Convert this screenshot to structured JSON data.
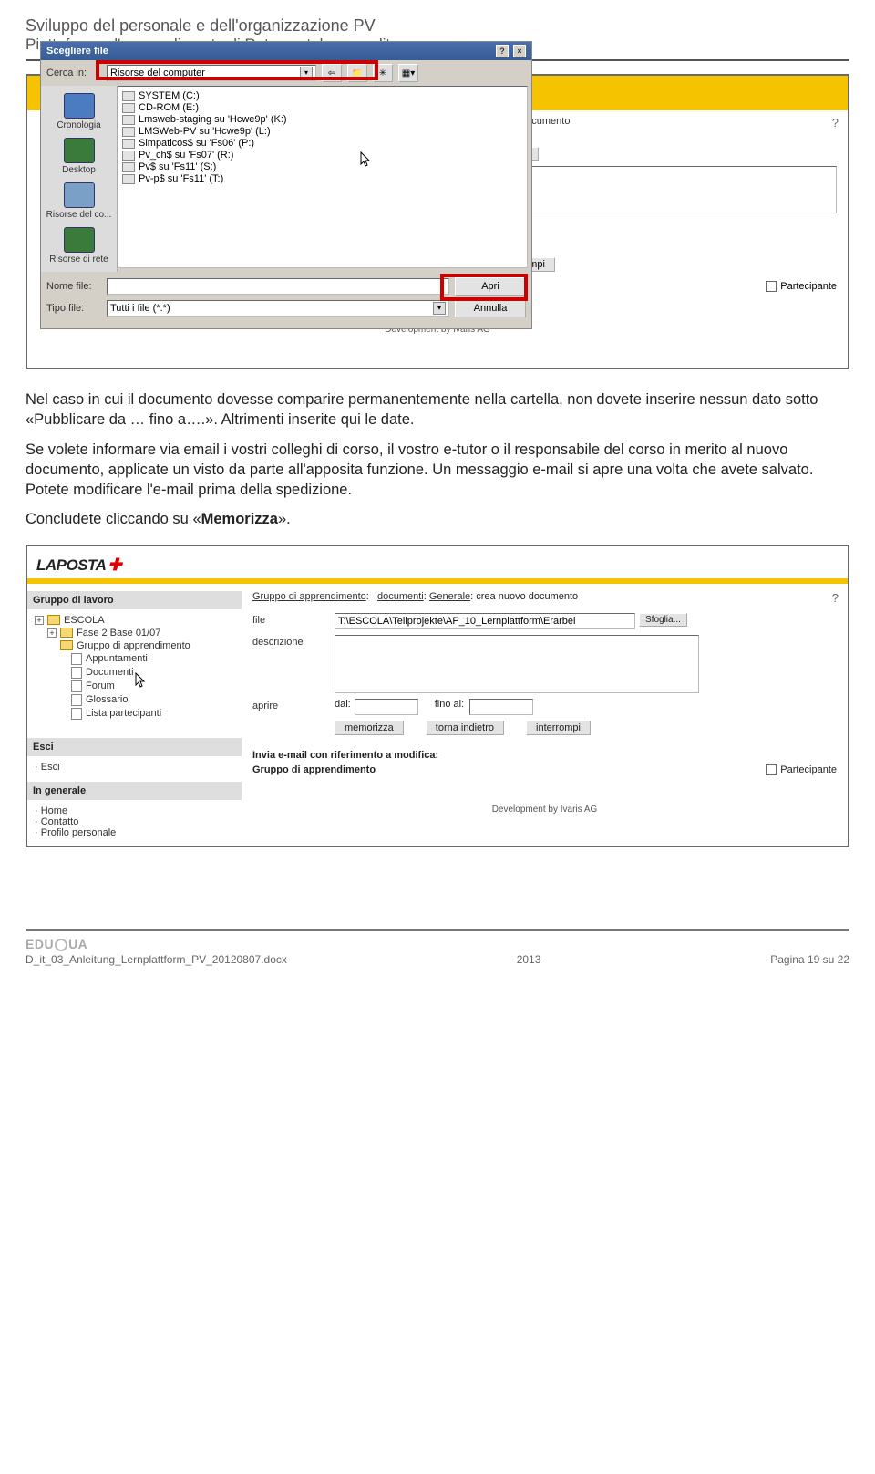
{
  "header": {
    "line1": "Sviluppo del personale e dell'organizzazione PV",
    "line2": "Piattaforma d'apprendimento di Rete postale e vendita"
  },
  "filepicker": {
    "title": "Scegliere file",
    "search_in_label": "Cerca in:",
    "search_in_value": "Risorse del computer",
    "drives": [
      "SYSTEM (C:)",
      "CD-ROM (E:)",
      "Lmsweb-staging su 'Hcwe9p' (K:)",
      "LMSWeb-PV su 'Hcwe9p' (L:)",
      "Simpaticos$ su 'Fs06' (P:)",
      "Pv_ch$ su 'Fs07' (R:)",
      "Pv$ su 'Fs11' (S:)",
      "Pv-p$ su 'Fs11' (T:)"
    ],
    "places": [
      "Cronologia",
      "Desktop",
      "Risorse del co...",
      "Risorse di rete"
    ],
    "file_label": "Nome file:",
    "type_label": "Tipo file:",
    "type_value": "Tutti i file (*.*)",
    "open_btn": "Apri",
    "cancel_btn": "Annulla"
  },
  "under": {
    "crumb_tail": "nuovo documento",
    "browse_btn": "Sfoglia...",
    "interrupt_btn": "interrompi",
    "participant_lbl": "Partecipante",
    "profile_link": "Profilo personale",
    "devline": "Development by Ivaris AG"
  },
  "copy": {
    "p1": "Nel caso in cui il documento dovesse comparire permanentemente nella cartella, non dovete inserire nessun dato sotto «Pubblicare da … fino a….». Altrimenti inserite qui le date.",
    "p2": "Se volete informare via email i vostri colleghi di corso, il vostro e-tutor o il responsabile del corso in merito al nuovo documento, applicate un visto da parte all'apposita funzione. Un messaggio e-mail si apre una volta che avete salvato. Potete modificare l'e-mail prima della spedizione.",
    "p3_pre": "Concludete cliccando su «",
    "p3_bold": "Memorizza",
    "p3_post": "»."
  },
  "shot2": {
    "logo_text": "LAPOSTA",
    "sections": {
      "group": "Gruppo di lavoro",
      "exit": "Esci",
      "general": "In generale"
    },
    "tree": {
      "root": "ESCOLA",
      "phase": "Fase 2 Base 01/07",
      "ga": "Gruppo di apprendimento",
      "items": [
        "Appuntamenti",
        "Documenti",
        "Forum",
        "Glossario",
        "Lista partecipanti"
      ]
    },
    "exit_link": "Esci",
    "general_links": [
      "Home",
      "Contatto",
      "Profilo personale"
    ],
    "breadcrumb": {
      "a": "Gruppo di apprendimento",
      "b": "documenti",
      "c": "Generale",
      "tail": "crea nuovo documento"
    },
    "form": {
      "file_lbl": "file",
      "file_val": "T:\\ESCOLA\\Teilprojekte\\AP_10_Lernplattform\\Erarbei",
      "browse": "Sfoglia...",
      "desc_lbl": "descrizione",
      "open_lbl": "aprire",
      "from_lbl": "dal:",
      "to_lbl": "fino al:",
      "save": "memorizza",
      "back": "torna indietro",
      "interrupt": "interrompi"
    },
    "sub": {
      "title": "Invia e-mail con riferimento a modifica:",
      "row_l": "Gruppo di apprendimento",
      "row_r": "Partecipante"
    },
    "devline": "Development by Ivaris AG"
  },
  "footer": {
    "edu": "EDU",
    "ua": "UA",
    "file": "D_it_03_Anleitung_Lernplattform_PV_20120807.docx",
    "year": "2013",
    "page": "Pagina 19 su 22"
  }
}
